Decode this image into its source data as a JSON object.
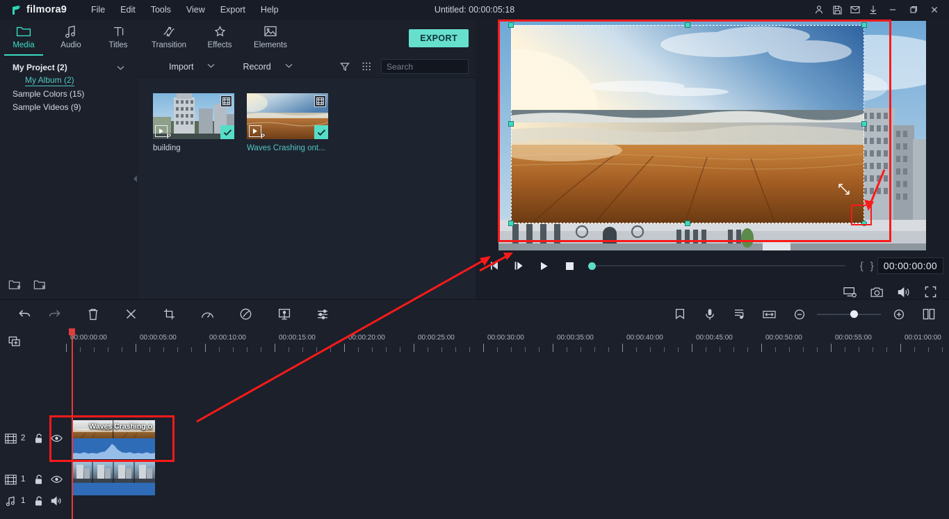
{
  "app": {
    "brand": "filmora9",
    "document_title": "Untitled: 00:00:05:18"
  },
  "menu": {
    "items": [
      "File",
      "Edit",
      "Tools",
      "View",
      "Export",
      "Help"
    ]
  },
  "titlebar_icons": [
    {
      "name": "account-icon",
      "glyph": "person"
    },
    {
      "name": "save-icon",
      "glyph": "save"
    },
    {
      "name": "mail-icon",
      "glyph": "mail"
    },
    {
      "name": "download-icon",
      "glyph": "download"
    },
    {
      "name": "minimize-button",
      "glyph": "minimize"
    },
    {
      "name": "maximize-button",
      "glyph": "maximize"
    },
    {
      "name": "close-button",
      "glyph": "close"
    }
  ],
  "tabs": {
    "items": [
      {
        "label": "Media",
        "icon": "folder-icon",
        "active": true
      },
      {
        "label": "Audio",
        "icon": "music-note-icon",
        "active": false
      },
      {
        "label": "Titles",
        "icon": "text-icon",
        "active": false
      },
      {
        "label": "Transition",
        "icon": "transition-icon",
        "active": false
      },
      {
        "label": "Effects",
        "icon": "effects-icon",
        "active": false
      },
      {
        "label": "Elements",
        "icon": "elements-icon",
        "active": false
      }
    ],
    "export_label": "EXPORT"
  },
  "library": {
    "items": [
      {
        "label": "My Project (2)",
        "level": 0,
        "bold": true,
        "selected": false,
        "caret": "chevron-down-icon"
      },
      {
        "label": "My Album (2)",
        "level": 1,
        "bold": false,
        "selected": true,
        "caret": ""
      },
      {
        "label": "Sample Colors (15)",
        "level": 0,
        "bold": false,
        "selected": false,
        "caret": ""
      },
      {
        "label": "Sample Videos (9)",
        "level": 0,
        "bold": false,
        "selected": false,
        "caret": ""
      }
    ],
    "bottom_icons": [
      {
        "name": "new-folder-icon"
      },
      {
        "name": "delete-folder-icon"
      }
    ]
  },
  "browser": {
    "import_label": "Import",
    "record_label": "Record",
    "filter_icon": "filter-icon",
    "grid_icon": "grid-view-icon",
    "search": {
      "placeholder": "Search",
      "value": ""
    },
    "cards": [
      {
        "name": "building",
        "selected": false,
        "type": "video"
      },
      {
        "name": "Waves Crashing ont...",
        "selected": true,
        "type": "video"
      }
    ]
  },
  "preview": {
    "timecode": "00:00:00:00",
    "controls": [
      {
        "name": "prev-frame-button",
        "glyph": "prev-frame"
      },
      {
        "name": "play-button",
        "glyph": "play-bar"
      },
      {
        "name": "next-play-button",
        "glyph": "play"
      },
      {
        "name": "stop-button",
        "glyph": "stop"
      }
    ],
    "mark_in_label": "{",
    "mark_out_label": "}",
    "bottom_icons": [
      {
        "name": "display-settings-icon"
      },
      {
        "name": "snapshot-icon"
      },
      {
        "name": "volume-icon"
      },
      {
        "name": "fullscreen-icon"
      }
    ]
  },
  "timeline_toolbar": {
    "left_icons": [
      {
        "name": "undo-button",
        "glyph": "undo",
        "dim": false
      },
      {
        "name": "redo-button",
        "glyph": "redo",
        "dim": true
      },
      {
        "name": "delete-button",
        "glyph": "trash",
        "dim": false
      },
      {
        "name": "split-button",
        "glyph": "scissors",
        "dim": false
      },
      {
        "name": "crop-button",
        "glyph": "crop",
        "dim": false
      },
      {
        "name": "speed-button",
        "glyph": "speed",
        "dim": false
      },
      {
        "name": "color-button",
        "glyph": "color",
        "dim": false
      },
      {
        "name": "green-screen-button",
        "glyph": "greenscreen",
        "dim": false
      },
      {
        "name": "audio-mixer-button",
        "glyph": "mixer",
        "dim": false
      }
    ],
    "right_icons": [
      {
        "name": "marker-button",
        "glyph": "marker"
      },
      {
        "name": "voiceover-button",
        "glyph": "mic"
      },
      {
        "name": "audio-detach-button",
        "glyph": "detach"
      },
      {
        "name": "fit-timeline-button",
        "glyph": "fit"
      },
      {
        "name": "zoom-out-button",
        "glyph": "minus-circle"
      },
      {
        "name": "zoom-in-button",
        "glyph": "plus-circle"
      },
      {
        "name": "layout-button",
        "glyph": "layout"
      }
    ]
  },
  "timeline": {
    "add_track_icon": "add-track-icon",
    "ruler_labels": [
      "00:00:00:00",
      "00:00:05:00",
      "00:00:10:00",
      "00:00:15:00",
      "00:00:20:00",
      "00:00:25:00",
      "00:00:30:00",
      "00:00:35:00",
      "00:00:40:00",
      "00:00:45:00",
      "00:00:50:00",
      "00:00:55:00",
      "00:01:00:00"
    ],
    "tracks": [
      {
        "type": "video",
        "number": "2",
        "lock": "unlocked",
        "visibility": "eye",
        "label": "Waves Crashing o"
      },
      {
        "type": "video",
        "number": "1",
        "lock": "unlocked",
        "visibility": "eye",
        "label": ""
      },
      {
        "type": "audio",
        "number": "1",
        "lock": "unlocked",
        "visibility": "speaker",
        "label": ""
      }
    ]
  },
  "annotations": {
    "accent_red": "#f91a1a",
    "accent_teal": "#3ddbc0",
    "callouts": [
      {
        "name": "preview-highlight-rect"
      },
      {
        "name": "corner-handle-highlight-rect"
      },
      {
        "name": "timeline-clip-highlight-rect"
      },
      {
        "name": "arrow-to-handle"
      },
      {
        "name": "arrow-clip-to-preview"
      },
      {
        "name": "arrow-to-player"
      }
    ]
  }
}
